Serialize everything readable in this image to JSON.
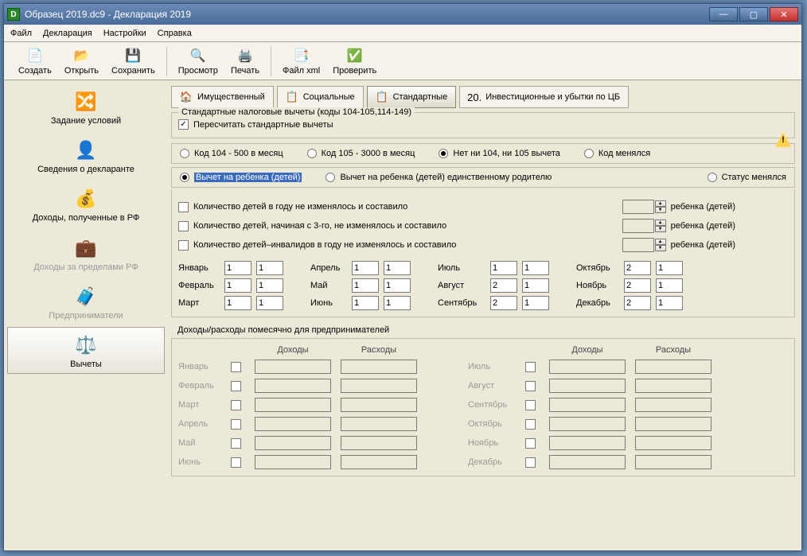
{
  "window": {
    "title": "Образец 2019.dc9 - Декларация 2019"
  },
  "menu": {
    "file": "Файл",
    "decl": "Декларация",
    "settings": "Настройки",
    "help": "Справка"
  },
  "toolbar": {
    "create": "Создать",
    "open": "Открыть",
    "save": "Сохранить",
    "preview": "Просмотр",
    "print": "Печать",
    "xml": "Файл xml",
    "check": "Проверить"
  },
  "sidebar": {
    "conditions": "Задание условий",
    "declarant": "Сведения о декларанте",
    "income_rf": "Доходы, полученные в РФ",
    "income_foreign": "Доходы за пределами РФ",
    "entrepreneurs": "Предприниматели",
    "deductions": "Вычеты"
  },
  "tabs": {
    "property": "Имущественный",
    "social": "Социальные",
    "standard": "Стандартные",
    "invest": "Инвестиционные и убытки по ЦБ"
  },
  "group": {
    "title": "Стандартные налоговые вычеты (коды 104-105,114-149)",
    "recalc": "Пересчитать стандартные вычеты"
  },
  "codes": {
    "c104": "Код 104 - 500 в месяц",
    "c105": "Код 105 - 3000 в месяц",
    "none": "Нет ни 104, ни 105 вычета",
    "changed": "Код менялся"
  },
  "child": {
    "children": "Вычет на ребенка (детей)",
    "single": "Вычет на ребенка (детей) единственному родителю",
    "status": "Статус менялся"
  },
  "counts": {
    "l1": "Количество детей в году не изменялось и составило",
    "l2": "Количество детей, начиная с 3-го, не изменялось и составило",
    "l3": "Количество детей–инвалидов в году не изменялось и составило",
    "unit": "ребенка (детей)"
  },
  "months": {
    "jan": "Январь",
    "feb": "Февраль",
    "mar": "Март",
    "apr": "Апрель",
    "may": "Май",
    "jun": "Июнь",
    "jul": "Июль",
    "aug": "Август",
    "sep": "Сентябрь",
    "oct": "Октябрь",
    "nov": "Ноябрь",
    "dec": "Декабрь"
  },
  "month_values": {
    "jan": [
      "1",
      "1"
    ],
    "feb": [
      "1",
      "1"
    ],
    "mar": [
      "1",
      "1"
    ],
    "apr": [
      "1",
      "1"
    ],
    "may": [
      "1",
      "1"
    ],
    "jun": [
      "1",
      "1"
    ],
    "jul": [
      "1",
      "1"
    ],
    "aug": [
      "2",
      "1"
    ],
    "sep": [
      "2",
      "1"
    ],
    "oct": [
      "2",
      "1"
    ],
    "nov": [
      "2",
      "1"
    ],
    "dec": [
      "2",
      "1"
    ]
  },
  "ent": {
    "title": "Доходы/расходы помесячно для предпринимателей",
    "income": "Доходы",
    "expense": "Расходы"
  }
}
